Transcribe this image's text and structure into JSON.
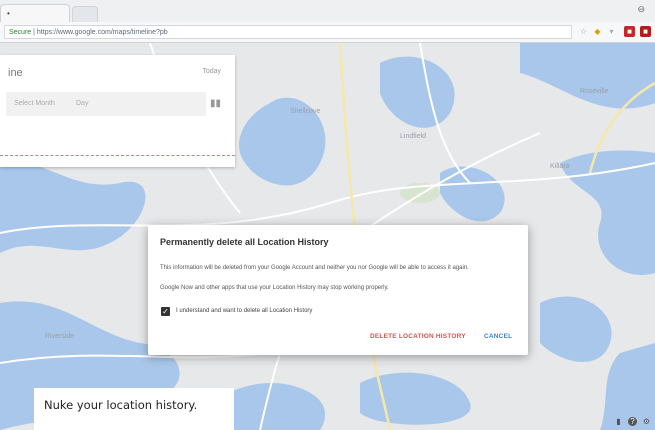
{
  "browser": {
    "tab_title": "•",
    "window_control": "⊖",
    "address": {
      "secure_label": "Secure",
      "url": "https://www.google.com/maps/timeline?pb"
    },
    "extension_icons": [
      "star-icon",
      "bookmark-icon",
      "menu-dots-icon",
      "extension-red-icon",
      "extension-shield-icon"
    ]
  },
  "panel": {
    "title": "ine",
    "link": "Today",
    "selects": [
      "Select Month",
      "Day"
    ]
  },
  "map": {
    "labels": [
      "Shellcove",
      "Lindfield",
      "Killara",
      "Roseville",
      "Riverside"
    ]
  },
  "dialog": {
    "title": "Permanently delete all Location History",
    "text1": "This information will be deleted from your Google Account and neither you nor Google will be able to access it again.",
    "text2": "Google Now and other apps that use your Location History may stop working properly.",
    "checkbox_label": "I understand and want to delete all Location History",
    "checkbox_checked": true,
    "delete_label": "DELETE LOCATION HISTORY",
    "cancel_label": "CANCEL"
  },
  "caption": "Nuke your location history.",
  "colors": {
    "water": "#a9c7ea",
    "land": "#e6e8ea",
    "road_yellow": "#f4e8a8",
    "delete": "#d9534f",
    "cancel": "#3f7fd6"
  }
}
